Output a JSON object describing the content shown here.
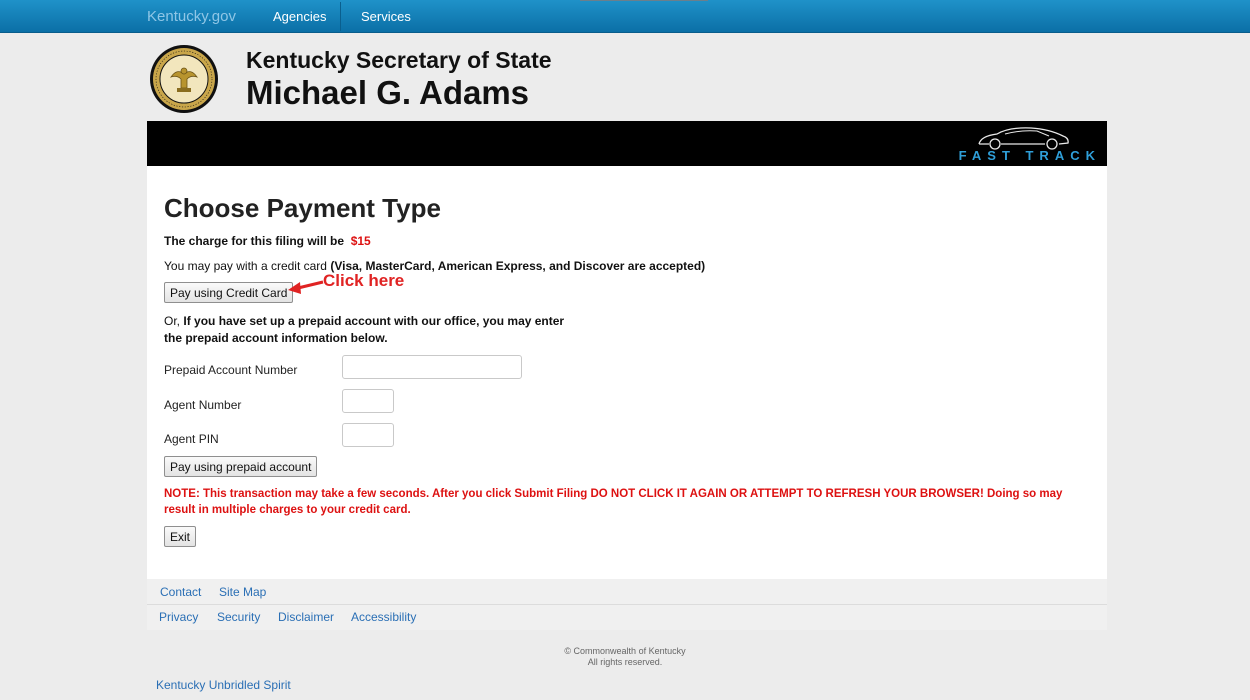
{
  "topbar": {
    "brand": "Kentucky.gov",
    "nav_agencies": "Agencies",
    "nav_services": "Services",
    "bg_color": "#1a8ac2"
  },
  "header": {
    "office_title": "Kentucky Secretary of State",
    "official_name": "Michael G. Adams",
    "seal_text": "COMMONWEALTH OF KENTUCKY · SECRETARY OF STATE"
  },
  "banner": {
    "logo_text": "FAST TRACK",
    "logo_color": "#2f9fd9"
  },
  "main": {
    "title": "Choose Payment Type",
    "charge_text": "The charge for this filing will be",
    "charge_amount": "$15",
    "credit_text": "You may pay with a credit card",
    "credit_cards": "(Visa, MasterCard, American Express, and Discover are accepted)",
    "credit_button": "Pay using Credit Card",
    "click_here": "Click here",
    "prepaid_or": "Or,",
    "prepaid_text_1": "If you have set up a prepaid account with our office, you may enter",
    "prepaid_text_2": "the prepaid account information below.",
    "fields": {
      "account_label": "Prepaid Account Number",
      "account_value": "",
      "agent_label": "Agent Number",
      "agent_value": "",
      "pin_label": "Agent PIN",
      "pin_value": ""
    },
    "prepaid_button": "Pay using prepaid account",
    "note": "NOTE: This transaction may take a few seconds. After you click Submit Filing DO NOT CLICK IT AGAIN OR ATTEMPT TO REFRESH YOUR BROWSER! Doing so may result in multiple charges to your credit card.",
    "exit_button": "Exit",
    "accent_red": "#d11111"
  },
  "footer": {
    "links_row1": [
      "Contact",
      "Site Map"
    ],
    "links_row2": [
      "Privacy",
      "Security",
      "Disclaimer",
      "Accessibility"
    ],
    "copyright": "© Commonwealth of Kentucky",
    "rights": "All rights reserved.",
    "spirit": "Kentucky Unbridled Spirit",
    "link_color": "#2a6fb5"
  }
}
